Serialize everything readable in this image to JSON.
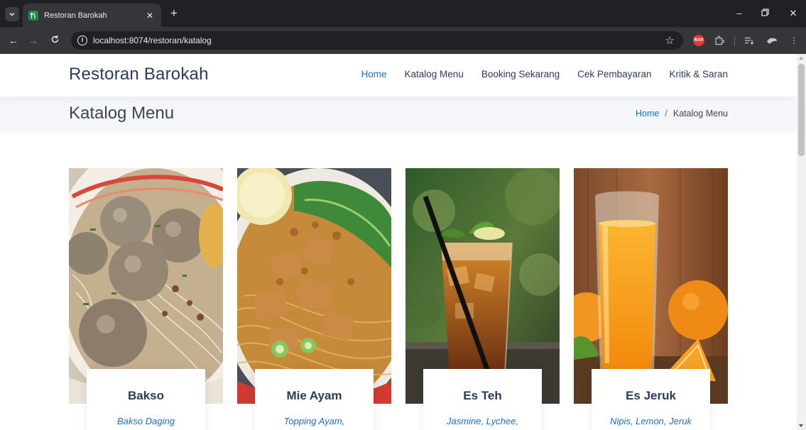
{
  "browser": {
    "tab_title": "Restoran Barokah",
    "url": "localhost:8074/restoran/katalog",
    "ext_badge": "RAR"
  },
  "site": {
    "brand": "Restoran Barokah",
    "nav": [
      "Home",
      "Katalog Menu",
      "Booking Sekarang",
      "Cek Pembayaran",
      "Kritik & Saran"
    ],
    "active_nav": "Home"
  },
  "breadcrumb": {
    "title": "Katalog Menu",
    "home": "Home",
    "separator": "/",
    "current": "Katalog Menu"
  },
  "menu_items": [
    {
      "name": "Bakso",
      "desc": "Bakso Daging",
      "image": "bakso-photo"
    },
    {
      "name": "Mie Ayam",
      "desc": "Topping Ayam,",
      "image": "mie-ayam-photo"
    },
    {
      "name": "Es Teh",
      "desc": "Jasmine, Lychee,",
      "image": "es-teh-photo"
    },
    {
      "name": "Es Jeruk",
      "desc": "Nipis, Lemon, Jeruk",
      "image": "es-jeruk-photo"
    }
  ],
  "colors": {
    "brand": "#2c3a5e",
    "accent": "#1a6fd1",
    "breadcrumb_bg": "#f4f6f9"
  }
}
